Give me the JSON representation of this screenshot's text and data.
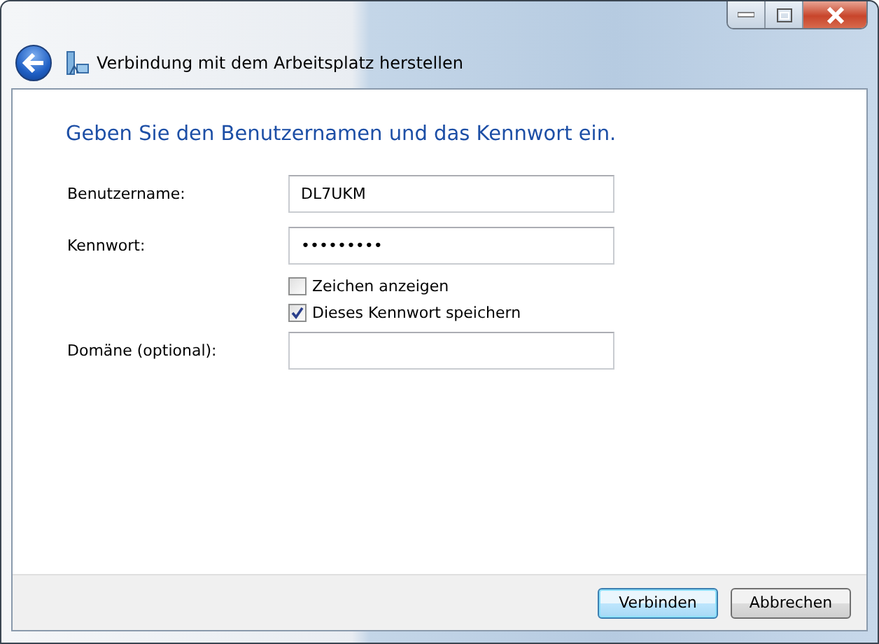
{
  "window": {
    "title": "Verbindung mit dem Arbeitsplatz herstellen"
  },
  "heading": "Geben Sie den Benutzernamen und das Kennwort ein.",
  "fields": [
    {
      "label": "Benutzername:",
      "value": "DL7UKM"
    },
    {
      "label": "Kennwort:",
      "value": "•••••••••"
    }
  ],
  "checkboxes": [
    {
      "label": "Zeichen anzeigen",
      "checked": false
    },
    {
      "label": "Dieses Kennwort speichern",
      "checked": true
    }
  ],
  "domain_field": {
    "label": "Domäne (optional):"
  },
  "buttons": [
    {
      "label": "Verbinden",
      "default": true
    },
    {
      "label": "Abbrechen",
      "default": false
    }
  ]
}
